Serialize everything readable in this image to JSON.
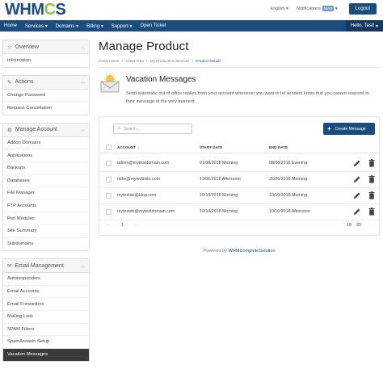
{
  "header": {
    "logo_text": "WHM",
    "logo_o": "C",
    "logo_tail": "S",
    "language": "English",
    "notifications": "Notifications",
    "notif_badge": "NEW",
    "logout": "Logout"
  },
  "nav": {
    "items": [
      "Home",
      "Services",
      "Domains",
      "Billing",
      "Support",
      "Open Ticket"
    ],
    "hello": "Hello, Test!"
  },
  "sidebar": {
    "overview": {
      "title": "Overview",
      "items": [
        "Information"
      ]
    },
    "actions": {
      "title": "Actions",
      "items": [
        "Change Password",
        "Request Cancellation"
      ]
    },
    "manage": {
      "title": "Manage Account",
      "items": [
        "Addon Domains",
        "Applications",
        "Backups",
        "Databases",
        "File Manager",
        "FTP Accounts",
        "Perl Modules",
        "Site Summary",
        "Subdomains"
      ]
    },
    "email": {
      "title": "Email Management",
      "items": [
        "Autoresponders",
        "Email Accounts",
        "Email Forwarders",
        "Mailing Lists",
        "SPAM Filters",
        "SpamAssasin Setup",
        "Vacation Messages"
      ]
    }
  },
  "main": {
    "title": "Manage Product",
    "breadcrumb": [
      "Portal Home",
      "Client Area",
      "My Products & Services",
      "Product Details"
    ],
    "section_title": "Vacation Messages",
    "description": "Send automatic out of office replies from your account whenever you want to let senders know that you cannot respond to their message at the very moment.",
    "search_placeholder": "Search...",
    "create_label": "Create Message",
    "columns": {
      "account": "ACCOUNT",
      "sort": "↑",
      "start": "START DATE",
      "end": "END DATE"
    },
    "rows": [
      {
        "account": "admin@mytestdomain.com",
        "start": "01/08/2018 Morning",
        "end": "08/08/2018 Evening"
      },
      {
        "account": "mike@mywebsite.com",
        "start": "13/06/2018 Afternoon",
        "end": "26/06/2018 Morning"
      },
      {
        "account": "mytestdo@blog.com",
        "start": "10/10/2018 Morning",
        "end": "10/10/2018 Morning"
      },
      {
        "account": "mytestdo@mytestdomain.com",
        "start": "10/10/2018 Morning",
        "end": "10/10/2018 Afternoon"
      }
    ],
    "pager": {
      "prev": "‹",
      "page": "1",
      "next": "›",
      "size_a": "10",
      "size_b": "25"
    }
  },
  "footer": {
    "prefix": "Powered by ",
    "link": "WHMCompleteSolution"
  },
  "colors": {
    "brand": "#1a4c7e",
    "accent": "#8fc33f",
    "active_sidebar": "#3a3a3a"
  }
}
